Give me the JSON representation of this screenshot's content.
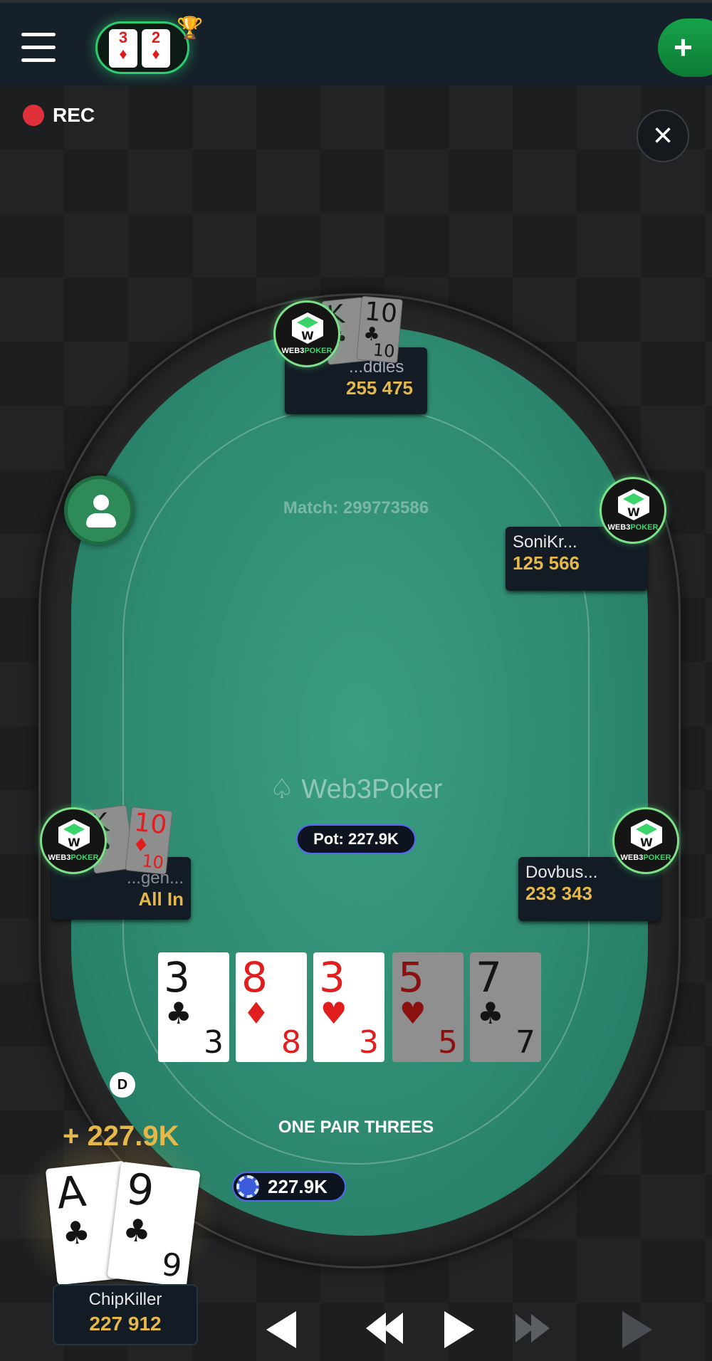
{
  "header": {
    "logo_cards": [
      {
        "rank": "3",
        "suit": "♦"
      },
      {
        "rank": "2",
        "suit": "♦"
      }
    ],
    "add_label": "+"
  },
  "recording": {
    "label": "REC"
  },
  "table": {
    "match_label": "Match: 299773586",
    "brand_label": "Web3Poker",
    "pot_label": "Pot: 227.9K",
    "hand_rank": "ONE PAIR THREES",
    "bet_amount": "227.9K",
    "dealer_label": "D",
    "avatar_brand": {
      "left": "WEB3",
      "right": "POKER"
    }
  },
  "board": [
    {
      "rank": "3",
      "suit": "♣",
      "color": "black",
      "highlighted": true
    },
    {
      "rank": "8",
      "suit": "♦",
      "color": "red",
      "highlighted": true
    },
    {
      "rank": "3",
      "suit": "♥",
      "color": "red",
      "highlighted": true
    },
    {
      "rank": "5",
      "suit": "♥",
      "color": "red",
      "highlighted": false
    },
    {
      "rank": "7",
      "suit": "♣",
      "color": "black",
      "highlighted": false
    }
  ],
  "players": {
    "top": {
      "name": "...ddles",
      "stack": "255 475",
      "cards": [
        {
          "rank": "K",
          "suit": "♣",
          "color": "black"
        },
        {
          "rank": "10",
          "suit": "♣",
          "color": "black"
        }
      ]
    },
    "right_upper": {
      "name": "SoniKr...",
      "stack": "125 566"
    },
    "left": {
      "name": "...gen...",
      "stack": "All In",
      "cards": [
        {
          "rank": "K",
          "suit": "♠",
          "color": "black"
        },
        {
          "rank": "10",
          "suit": "♦",
          "color": "red"
        }
      ]
    },
    "right_lower": {
      "name": "Dovbus...",
      "stack": "233 343"
    }
  },
  "hero": {
    "name": "ChipKiller",
    "stack": "227 912",
    "win_amount": "+ 227.9K",
    "cards": [
      {
        "rank": "A",
        "suit": "♣",
        "color": "black"
      },
      {
        "rank": "9",
        "suit": "♣",
        "color": "black"
      }
    ]
  },
  "controls": [
    "previous-street",
    "rewind",
    "play",
    "fast-forward",
    "next"
  ]
}
